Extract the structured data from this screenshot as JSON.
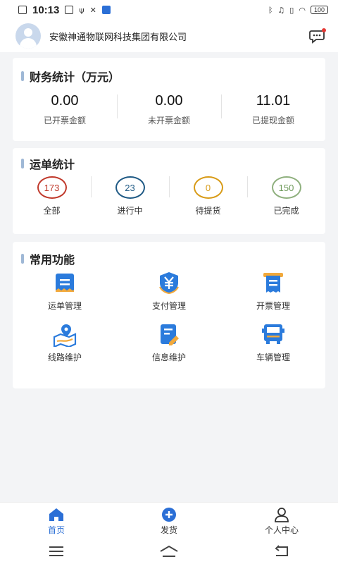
{
  "status_bar": {
    "time": "10:13",
    "battery": "100"
  },
  "header": {
    "company_name": "安徽神通物联网科技集团有限公司"
  },
  "finance": {
    "title": "财务统计（万元）",
    "items": [
      {
        "value": "0.00",
        "label": "已开票金额"
      },
      {
        "value": "0.00",
        "label": "未开票金额"
      },
      {
        "value": "11.01",
        "label": "已提现金额"
      }
    ]
  },
  "waybill": {
    "title": "运单统计",
    "items": [
      {
        "count": "173",
        "label": "全部",
        "color": "#c0392b"
      },
      {
        "count": "23",
        "label": "进行中",
        "color": "#1f5a85"
      },
      {
        "count": "0",
        "label": "待提货",
        "color": "#d89b17"
      },
      {
        "count": "150",
        "label": "已完成",
        "color": "#6e9a5a"
      }
    ]
  },
  "functions": {
    "title": "常用功能",
    "items": [
      {
        "label": "运单管理",
        "icon": "waybill-icon"
      },
      {
        "label": "支付管理",
        "icon": "payment-icon"
      },
      {
        "label": "开票管理",
        "icon": "invoice-icon"
      },
      {
        "label": "线路维护",
        "icon": "route-icon"
      },
      {
        "label": "信息维护",
        "icon": "info-icon"
      },
      {
        "label": "车辆管理",
        "icon": "truck-icon"
      }
    ]
  },
  "tabs": [
    {
      "label": "首页",
      "icon": "home-icon"
    },
    {
      "label": "发货",
      "icon": "plus-circle-icon"
    },
    {
      "label": "个人中心",
      "icon": "person-icon"
    }
  ],
  "colors": {
    "accent": "#2b6fd6",
    "card_title_bar": "#9fb8d6"
  }
}
